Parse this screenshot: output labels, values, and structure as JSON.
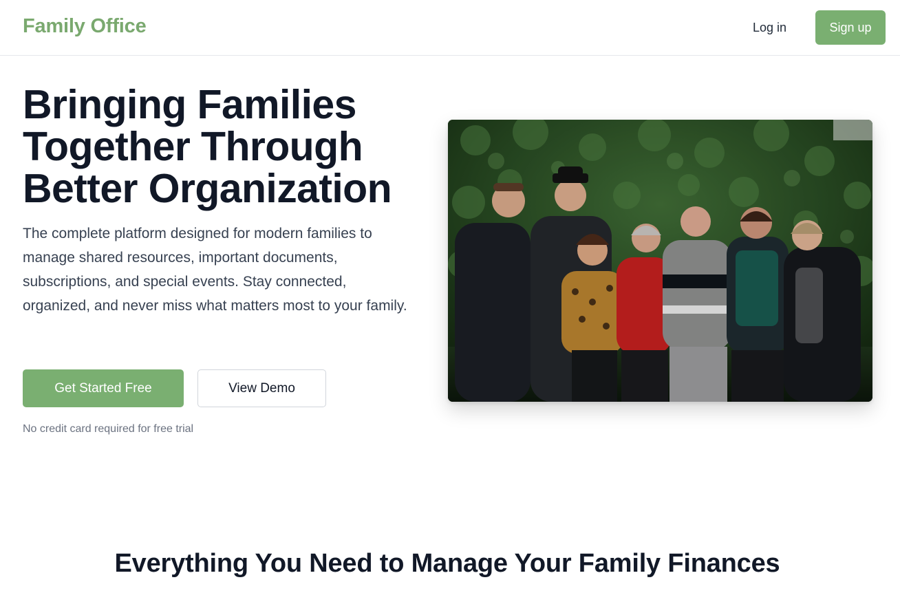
{
  "header": {
    "brand": "Family Office",
    "login_label": "Log in",
    "signup_label": "Sign up"
  },
  "hero": {
    "title_lines": [
      "Bringing Families",
      "Together Through",
      "Better Organization"
    ],
    "description": "The complete platform designed for modern families to manage shared resources, important documents, subscriptions, and special events. Stay connected, organized, and never miss what matters most to your family.",
    "primary_cta": "Get Started Free",
    "secondary_cta": "View Demo",
    "note": "No credit card required for free trial"
  },
  "features": {
    "title": "Everything You Need to Manage Your Family Finances"
  },
  "colors": {
    "brand": "#7aa96f",
    "primary_button": "#7aaf71",
    "heading": "#111827",
    "body_text": "#374151",
    "muted_text": "#6b7280"
  }
}
